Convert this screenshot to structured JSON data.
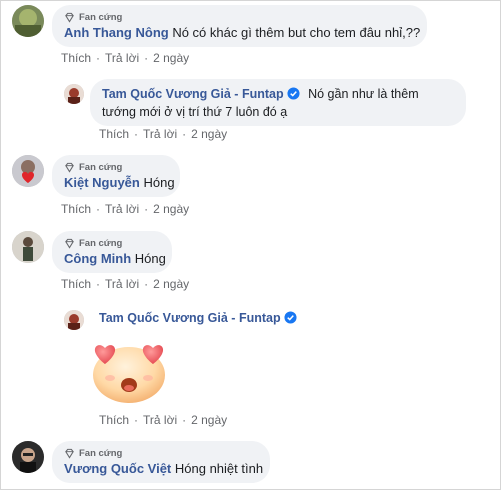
{
  "fan_badge": "Fan cứng",
  "comments": [
    {
      "author": "Anh Thang Nông",
      "text": "Nó có khác gì thêm but cho tem đâu nhỉ,??",
      "like": "Thích",
      "reply": "Trả lời",
      "time": "2 ngày"
    },
    {
      "author": "Kiệt Nguyễn",
      "text": "Hóng",
      "like": "Thích",
      "reply": "Trả lời",
      "time": "2 ngày"
    },
    {
      "author": "Công Minh",
      "text": "Hóng",
      "like": "Thích",
      "reply": "Trả lời",
      "time": "2 ngày"
    },
    {
      "author": "Vương Quốc Việt",
      "text": "Hóng nhiệt tình"
    }
  ],
  "replies": [
    {
      "author": "Tam Quốc Vương Giả - Funtap",
      "text_line1": "Nó gần như là thêm",
      "text_line2": "tướng mới ở vị trí thứ 7 luôn đó ạ",
      "like": "Thích",
      "reply": "Trả lời",
      "time": "2 ngày"
    },
    {
      "author": "Tam Quốc Vương Giả - Funtap",
      "sticker": "heart-eyes-emoji",
      "like": "Thích",
      "reply": "Trả lời",
      "time": "2 ngày"
    }
  ],
  "colors": {
    "author": "#385898",
    "bubble": "#f0f2f5",
    "meta": "#65676b",
    "verified": "#1877f2"
  }
}
